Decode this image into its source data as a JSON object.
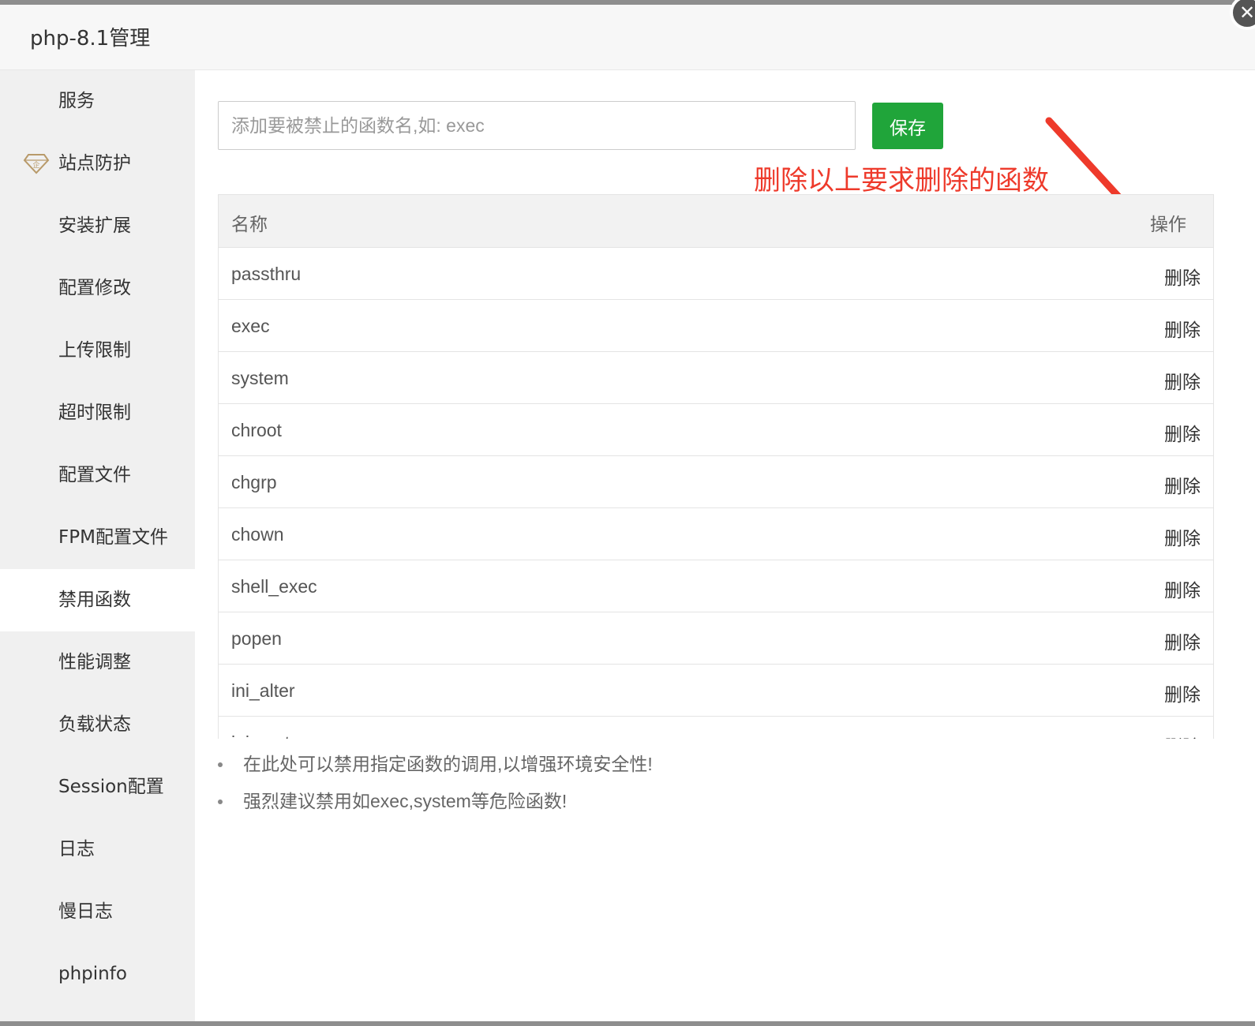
{
  "modal": {
    "title": "php-8.1管理",
    "close_label": "✕"
  },
  "sidebar": {
    "items": [
      {
        "label": "服务"
      },
      {
        "label": "站点防护",
        "icon": "enterprise-diamond-icon",
        "icon_text": "企"
      },
      {
        "label": "安装扩展"
      },
      {
        "label": "配置修改"
      },
      {
        "label": "上传限制"
      },
      {
        "label": "超时限制"
      },
      {
        "label": "配置文件"
      },
      {
        "label": "FPM配置文件"
      },
      {
        "label": "禁用函数",
        "active": true
      },
      {
        "label": "性能调整"
      },
      {
        "label": "负载状态"
      },
      {
        "label": "Session配置"
      },
      {
        "label": "日志"
      },
      {
        "label": "慢日志"
      },
      {
        "label": "phpinfo"
      }
    ]
  },
  "main": {
    "search": {
      "placeholder": "添加要被禁止的函数名,如: exec",
      "value": ""
    },
    "save_label": "保存",
    "annotation": "删除以上要求删除的函数",
    "table": {
      "col_name": "名称",
      "col_op": "操作",
      "rows": [
        {
          "name": "passthru",
          "op": "删除"
        },
        {
          "name": "exec",
          "op": "删除"
        },
        {
          "name": "system",
          "op": "删除"
        },
        {
          "name": "chroot",
          "op": "删除"
        },
        {
          "name": "chgrp",
          "op": "删除"
        },
        {
          "name": "chown",
          "op": "删除"
        },
        {
          "name": "shell_exec",
          "op": "删除"
        },
        {
          "name": "popen",
          "op": "删除"
        },
        {
          "name": "ini_alter",
          "op": "删除"
        },
        {
          "name": "ini_restore",
          "op": "删除"
        }
      ]
    },
    "tips": [
      "在此处可以禁用指定函数的调用,以增强环境安全性!",
      "强烈建议禁用如exec,system等危险函数!"
    ]
  },
  "colors": {
    "save_button": "#20a53a",
    "annotation": "#ee3a2b",
    "sidebar_bg": "#f0f0f0"
  }
}
